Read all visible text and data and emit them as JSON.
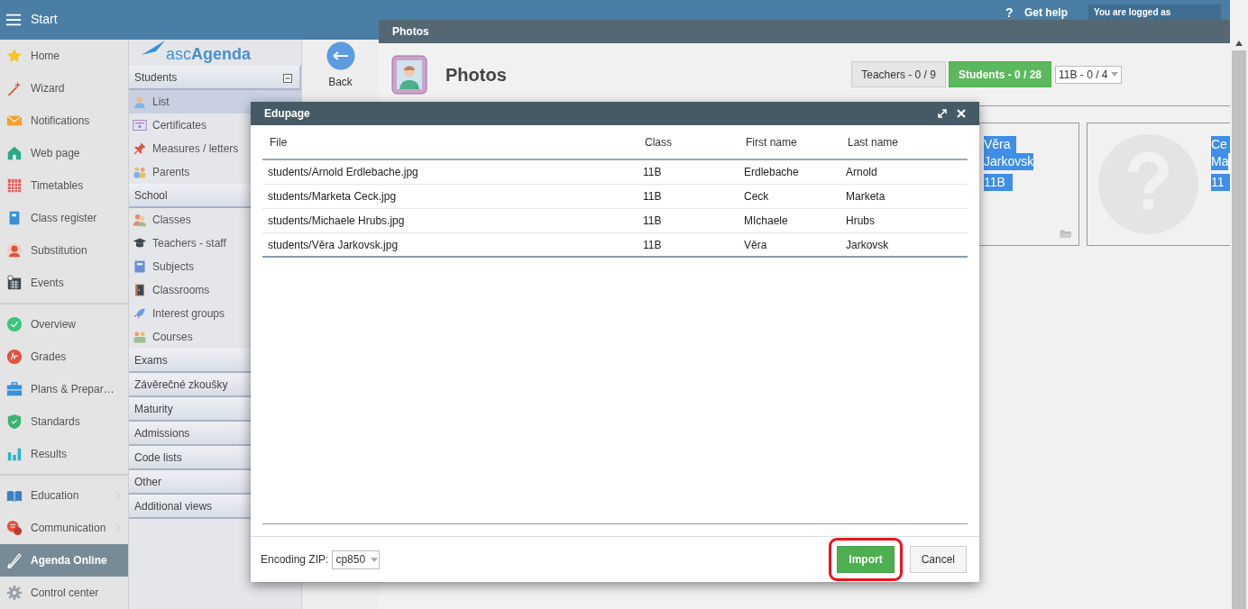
{
  "top_bar": {
    "menu_label": "Start",
    "help_icon": "?",
    "help": "Get help",
    "login": "You are logged as"
  },
  "sidebar": {
    "groups": [
      [
        {
          "label": "Home",
          "selected": false,
          "submenu": false
        },
        {
          "label": "Wizard",
          "selected": false,
          "submenu": false
        },
        {
          "label": "Notifications",
          "selected": false,
          "submenu": false
        },
        {
          "label": "Web page",
          "selected": false,
          "submenu": false
        },
        {
          "label": "Timetables",
          "selected": false,
          "submenu": false
        },
        {
          "label": "Class register",
          "selected": false,
          "submenu": false
        },
        {
          "label": "Substitution",
          "selected": false,
          "submenu": false
        },
        {
          "label": "Events",
          "selected": false,
          "submenu": false
        }
      ],
      [
        {
          "label": "Overview",
          "selected": false,
          "submenu": false
        },
        {
          "label": "Grades",
          "selected": false,
          "submenu": false
        },
        {
          "label": "Plans & Prepar…",
          "selected": false,
          "submenu": false
        },
        {
          "label": "Standards",
          "selected": false,
          "submenu": false
        },
        {
          "label": "Results",
          "selected": false,
          "submenu": false
        }
      ],
      [
        {
          "label": "Education",
          "selected": false,
          "submenu": true
        },
        {
          "label": "Communication",
          "selected": false,
          "submenu": true
        },
        {
          "label": "Agenda Online",
          "selected": true,
          "submenu": false
        },
        {
          "label": "Control center",
          "selected": false,
          "submenu": false
        }
      ]
    ]
  },
  "agenda_nav": {
    "logo": "asc**Agenda**",
    "sections": [
      {
        "title": "Students",
        "toggle": true,
        "items": [
          {
            "label": "List",
            "selected": true
          },
          {
            "label": "Certificates",
            "selected": false
          },
          {
            "label": "Measures / letters",
            "selected": false
          },
          {
            "label": "Parents",
            "selected": false
          }
        ]
      },
      {
        "title": "School",
        "items": [
          {
            "label": "Classes",
            "selected": false
          },
          {
            "label": "Teachers - staff",
            "selected": false
          },
          {
            "label": "Subjects",
            "selected": false
          },
          {
            "label": "Classrooms",
            "selected": false
          },
          {
            "label": "Interest groups",
            "selected": false
          },
          {
            "label": "Courses",
            "selected": false
          }
        ]
      },
      {
        "title": "Exams"
      },
      {
        "title": "Závěrečné zkoušky"
      },
      {
        "title": "Maturity"
      },
      {
        "title": "Admissions"
      },
      {
        "title": "Code lists"
      },
      {
        "title": "Other"
      },
      {
        "title": "Additional views"
      }
    ]
  },
  "back_button": {
    "label": "Back"
  },
  "photos_window": {
    "title": "Photos",
    "heading": "Photos",
    "tabs": [
      {
        "label": "Teachers - 0 / 9",
        "selected": false
      },
      {
        "label": "Students - 0 / 28",
        "selected": true
      }
    ],
    "class_select": {
      "value": "11B - 0 / 4"
    },
    "cards": [
      {
        "first_name": "Věra",
        "last_name": "Jarkovsk",
        "class": "11B",
        "highlighted": true,
        "placeholder_photo": false,
        "folder_button": true
      },
      {
        "first_name": "Ce",
        "last_name": "Ma",
        "class": "11",
        "highlighted": true,
        "placeholder_photo": true,
        "folder_button": false
      }
    ]
  },
  "dialog": {
    "title": "Edupage",
    "table": {
      "columns": [
        "File",
        "Class",
        "First name",
        "Last name"
      ],
      "rows": [
        [
          "students/Arnold Erdlebache.jpg",
          "11B",
          "Erdlebache",
          "Arnold"
        ],
        [
          "students/Marketa Ceck.jpg",
          "11B",
          "Ceck",
          "Marketa"
        ],
        [
          "students/Michaele Hrubs.jpg",
          "11B",
          "MIchaele",
          "Hrubs"
        ],
        [
          "students/Věra Jarkovsk.jpg",
          "11B",
          "Věra",
          "Jarkovsk"
        ]
      ]
    },
    "encoding_label": "Encoding ZIP:",
    "encoding_value": "cp850",
    "buttons": [
      {
        "label": "Import",
        "kind": "primary",
        "highlighted": true
      },
      {
        "label": "Cancel",
        "kind": "secondary",
        "highlighted": false
      }
    ]
  }
}
